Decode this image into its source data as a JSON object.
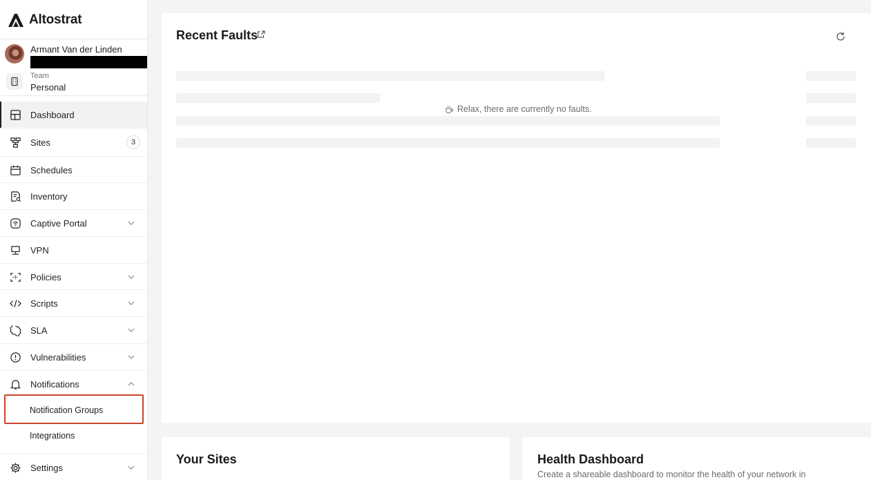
{
  "brand": {
    "name": "Altostrat"
  },
  "user": {
    "name": "Armant Van der Linden"
  },
  "team": {
    "label": "Team",
    "value": "Personal"
  },
  "nav": {
    "dashboard": "Dashboard",
    "sites": "Sites",
    "sites_badge": "3",
    "schedules": "Schedules",
    "inventory": "Inventory",
    "captive_portal": "Captive Portal",
    "vpn": "VPN",
    "policies": "Policies",
    "scripts": "Scripts",
    "sla": "SLA",
    "vulnerabilities": "Vulnerabilities",
    "notifications": "Notifications",
    "notification_groups": "Notification Groups",
    "integrations": "Integrations",
    "settings": "Settings"
  },
  "faults": {
    "title": "Recent Faults",
    "empty_message": "Relax, there are currently no faults."
  },
  "sites_panel": {
    "title": "Your Sites"
  },
  "health_panel": {
    "title": "Health Dashboard",
    "description": "Create a shareable dashboard to monitor the health of your network in"
  },
  "colors": {
    "highlight": "#c8452c",
    "active_border": "#1f1f1f"
  }
}
